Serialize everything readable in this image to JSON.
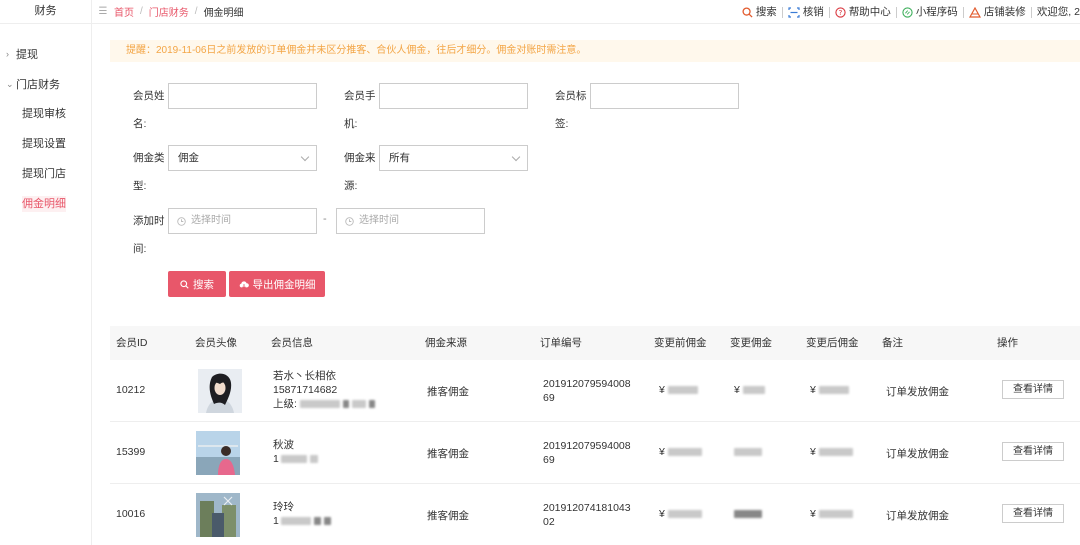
{
  "sidebar": {
    "brand": "财务",
    "groups": [
      {
        "label": "提现",
        "caret": "›"
      },
      {
        "label": "门店财务",
        "caret": "⌄"
      }
    ],
    "items": [
      {
        "label": "提现审核"
      },
      {
        "label": "提现设置"
      },
      {
        "label": "提现门店"
      },
      {
        "label": "佣金明细"
      }
    ]
  },
  "header": {
    "breadcrumb": [
      "首页",
      "门店财务",
      "佣金明细"
    ],
    "links": [
      {
        "label": "搜索",
        "icon": "search-icon"
      },
      {
        "label": "核销",
        "icon": "scan-icon"
      },
      {
        "label": "帮助中心",
        "icon": "help-icon"
      },
      {
        "label": "小程序码",
        "icon": "miniapp-icon"
      },
      {
        "label": "店铺装修",
        "icon": "decorate-icon"
      },
      {
        "label": "欢迎您, 2",
        "icon": ""
      }
    ]
  },
  "notice": "提醒：2019-11-06日之前发放的订单佣金并未区分推客、合伙人佣金，往后才细分。佣金对账时需注意。",
  "filters": {
    "member_name_label": "会员姓名:",
    "member_phone_label": "会员手机:",
    "member_tag_label": "会员标签:",
    "commission_type_label": "佣金类型:",
    "commission_type_value": "佣金",
    "commission_source_label": "佣金来源:",
    "commission_source_value": "所有",
    "add_time_label": "添加时间:",
    "start_placeholder": "选择时间",
    "end_placeholder": "选择时间",
    "range_sep": "-",
    "search_button": "搜索",
    "export_button": "导出佣金明细"
  },
  "table": {
    "columns": [
      "会员ID",
      "会员头像",
      "会员信息",
      "佣金来源",
      "订单编号",
      "变更前佣金",
      "变更佣金",
      "变更后佣金",
      "备注",
      "操作"
    ],
    "rows": [
      {
        "id": "10212",
        "name": "若水丶长相依",
        "phone": "15871714682",
        "parent_label": "上级:",
        "source": "推客佣金",
        "order_no_1": "201912079594008",
        "order_no_2": "69",
        "before_prefix": "¥",
        "change_prefix": "¥",
        "after_prefix": "¥",
        "remark": "订单发放佣金",
        "action": "查看详情"
      },
      {
        "id": "15399",
        "name": "秋波",
        "phone": "1",
        "source": "推客佣金",
        "order_no_1": "201912079594008",
        "order_no_2": "69",
        "before_prefix": "¥",
        "change_prefix": "",
        "after_prefix": "¥",
        "remark": "订单发放佣金",
        "action": "查看详情"
      },
      {
        "id": "10016",
        "name": "玲玲",
        "phone": "1",
        "source": "推客佣金",
        "order_no_1": "201912074181043",
        "order_no_2": "02",
        "before_prefix": "¥",
        "change_prefix": "",
        "after_prefix": "¥",
        "remark": "订单发放佣金",
        "action": "查看详情"
      }
    ]
  },
  "colors": {
    "accent": "#e8576a",
    "notice_text": "#f3a545",
    "notice_bg": "#fff8ec"
  }
}
